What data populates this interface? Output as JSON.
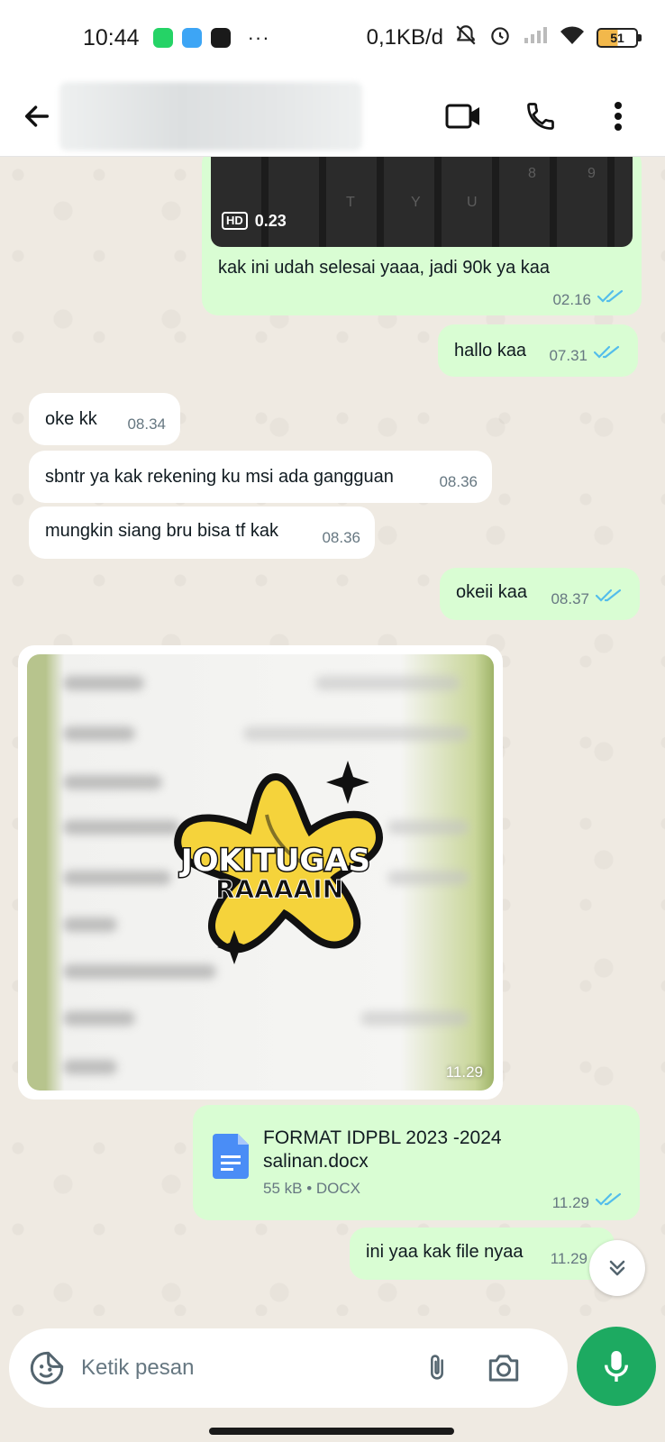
{
  "status_bar": {
    "time": "10:44",
    "network_speed": "0,1KB/d",
    "battery": "51",
    "overflow": "···"
  },
  "header": {
    "icons": [
      "back-arrow-icon",
      "video-call-icon",
      "voice-call-icon",
      "more-vert-icon"
    ]
  },
  "messages": [
    {
      "dir": "out",
      "type": "video",
      "duration": "0.23",
      "hd": "HD",
      "text": "kak ini udah selesai yaaa, jadi 90k ya kaa",
      "time": "02.16",
      "read": true
    },
    {
      "dir": "out",
      "type": "text",
      "text": "hallo kaa",
      "time": "07.31",
      "read": true
    },
    {
      "dir": "in",
      "type": "text",
      "text": "oke kk",
      "time": "08.34"
    },
    {
      "dir": "in",
      "type": "text",
      "text": "sbntr ya kak rekening ku msi ada gangguan",
      "time": "08.36"
    },
    {
      "dir": "in",
      "type": "text",
      "text": "mungkin siang bru bisa tf kak",
      "time": "08.36"
    },
    {
      "dir": "out",
      "type": "text",
      "text": "okeii kaa",
      "time": "08.37",
      "read": true
    },
    {
      "dir": "in",
      "type": "image",
      "time": "11.29"
    },
    {
      "dir": "out",
      "type": "document",
      "title_line1": "FORMAT IDPBL 2023 -2024",
      "title_line2": "salinan.docx",
      "size": "55 kB • DOCX",
      "time": "11.29",
      "read": true
    },
    {
      "dir": "out",
      "type": "text",
      "text": "ini yaa kak file nyaa",
      "time": "11.29"
    }
  ],
  "composer": {
    "placeholder": "Ketik pesan"
  },
  "colors": {
    "outgoing_bubble": "#d9fdd3",
    "incoming_bubble": "#ffffff",
    "read_ticks": "#53bdeb",
    "mic_button": "#1daa61",
    "chat_background": "#efeae2"
  }
}
